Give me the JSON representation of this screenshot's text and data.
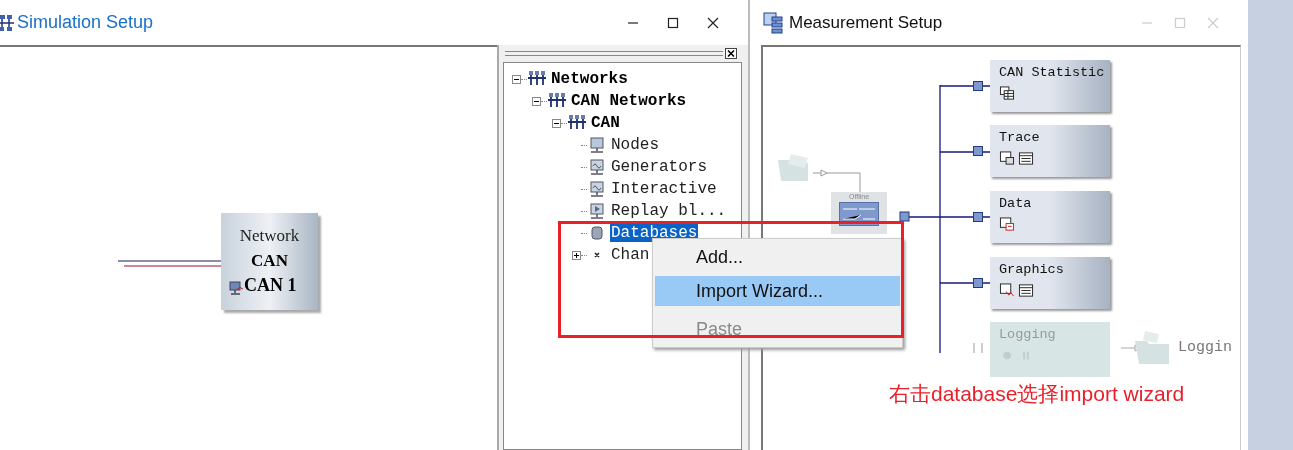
{
  "simulation_window": {
    "title": "Simulation Setup",
    "network_node": {
      "label": "Network",
      "bus": "CAN",
      "channel": "CAN 1"
    }
  },
  "tree": [
    {
      "label": "Networks",
      "kind": "network",
      "selected": false,
      "expanded": true,
      "children": [
        {
          "label": "CAN Networks",
          "kind": "network",
          "selected": false,
          "expanded": true,
          "children": [
            {
              "label": "CAN",
              "kind": "network",
              "selected": false,
              "expanded": true,
              "children": [
                {
                  "label": "Nodes",
                  "kind": "nodes",
                  "selected": false
                },
                {
                  "label": "Generators",
                  "kind": "generators",
                  "selected": false
                },
                {
                  "label": "Interactive",
                  "kind": "generators",
                  "selected": false
                },
                {
                  "label": "Replay bl...",
                  "kind": "replay",
                  "selected": false
                },
                {
                  "label": "Databases",
                  "kind": "database",
                  "selected": true
                },
                {
                  "label": "Chan",
                  "kind": "channels",
                  "selected": false,
                  "expanded": false
                }
              ]
            }
          ]
        }
      ]
    }
  ],
  "context_menu": [
    {
      "label": "Add...",
      "selected": false,
      "disabled": false
    },
    {
      "label": "Import Wizard...",
      "selected": true,
      "disabled": false
    },
    {
      "label": "Paste",
      "selected": false,
      "disabled": true
    }
  ],
  "measurement_window": {
    "title": "Measurement Setup",
    "source": {
      "label": "Offline"
    },
    "blocks": [
      {
        "label": "CAN Statistic",
        "kind": "statistic",
        "disabled": false
      },
      {
        "label": "Trace",
        "kind": "trace",
        "disabled": false
      },
      {
        "label": "Data",
        "kind": "data",
        "disabled": false
      },
      {
        "label": "Graphics",
        "kind": "graphics",
        "disabled": false
      },
      {
        "label": "Logging",
        "kind": "logging",
        "disabled": true
      }
    ],
    "logging_output": "Loggin"
  },
  "annotation": "右击database选择import wizard"
}
